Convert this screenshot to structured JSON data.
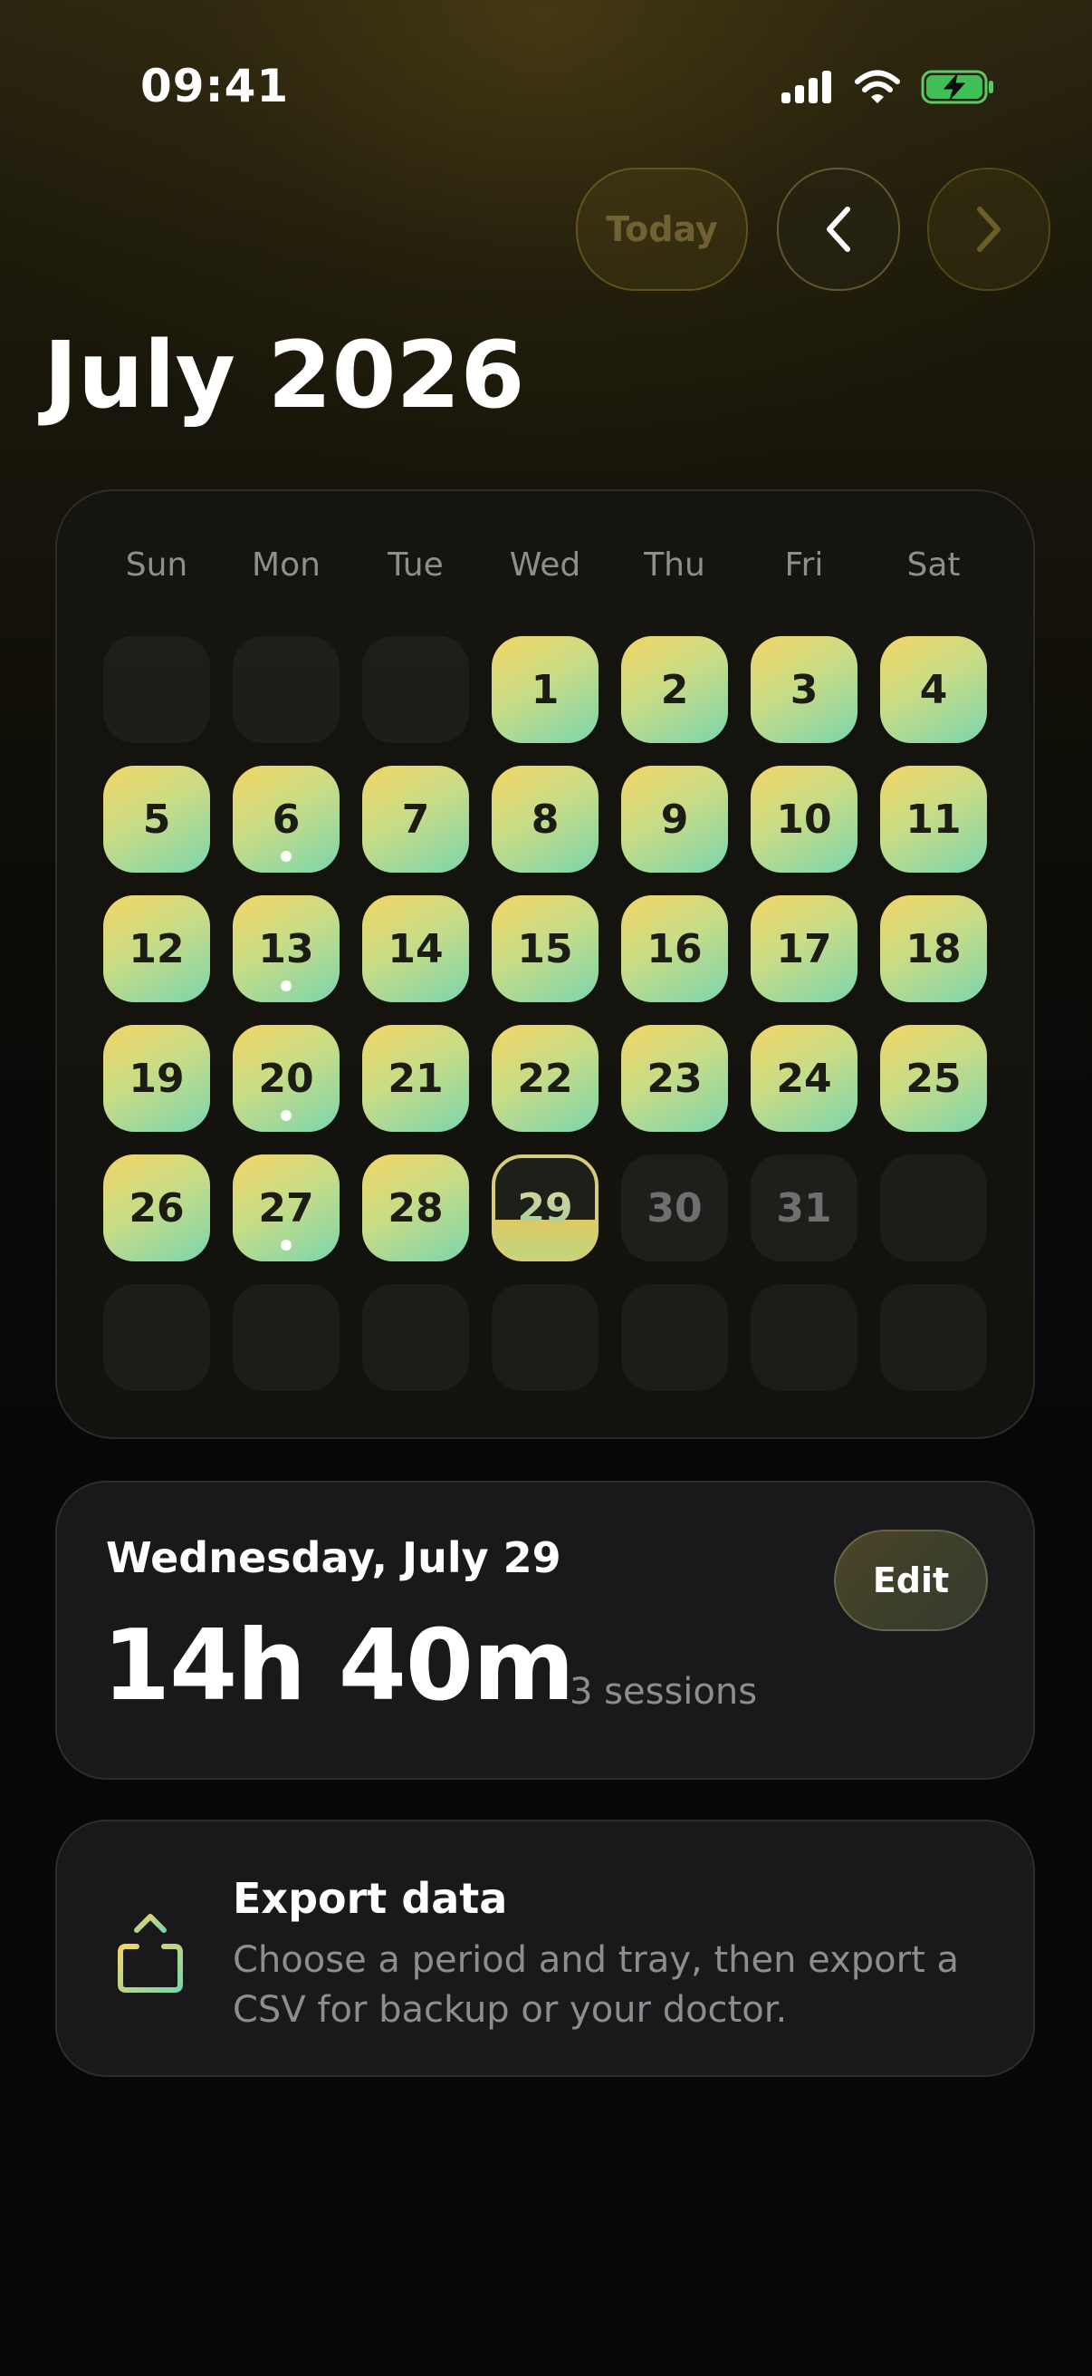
{
  "status_bar": {
    "time": "09:41"
  },
  "nav": {
    "today_label": "Today"
  },
  "calendar": {
    "month_title": "July 2026",
    "weekdays": [
      "Sun",
      "Mon",
      "Tue",
      "Wed",
      "Thu",
      "Fri",
      "Sat"
    ],
    "days": [
      {
        "label": "",
        "state": "empty"
      },
      {
        "label": "",
        "state": "empty"
      },
      {
        "label": "",
        "state": "empty"
      },
      {
        "label": "1",
        "state": "filled"
      },
      {
        "label": "2",
        "state": "filled"
      },
      {
        "label": "3",
        "state": "filled"
      },
      {
        "label": "4",
        "state": "filled"
      },
      {
        "label": "5",
        "state": "filled"
      },
      {
        "label": "6",
        "state": "filled",
        "dot": true
      },
      {
        "label": "7",
        "state": "filled"
      },
      {
        "label": "8",
        "state": "filled"
      },
      {
        "label": "9",
        "state": "filled"
      },
      {
        "label": "10",
        "state": "filled"
      },
      {
        "label": "11",
        "state": "filled"
      },
      {
        "label": "12",
        "state": "filled"
      },
      {
        "label": "13",
        "state": "filled",
        "dot": true
      },
      {
        "label": "14",
        "state": "filled"
      },
      {
        "label": "15",
        "state": "filled"
      },
      {
        "label": "16",
        "state": "filled"
      },
      {
        "label": "17",
        "state": "filled"
      },
      {
        "label": "18",
        "state": "filled"
      },
      {
        "label": "19",
        "state": "filled"
      },
      {
        "label": "20",
        "state": "filled",
        "dot": true
      },
      {
        "label": "21",
        "state": "filled"
      },
      {
        "label": "22",
        "state": "filled"
      },
      {
        "label": "23",
        "state": "filled"
      },
      {
        "label": "24",
        "state": "filled"
      },
      {
        "label": "25",
        "state": "filled"
      },
      {
        "label": "26",
        "state": "filled"
      },
      {
        "label": "27",
        "state": "filled",
        "dot": true
      },
      {
        "label": "28",
        "state": "filled"
      },
      {
        "label": "29",
        "state": "today",
        "progress": 0.38
      },
      {
        "label": "30",
        "state": "future"
      },
      {
        "label": "31",
        "state": "future"
      },
      {
        "label": "",
        "state": "empty"
      },
      {
        "label": "",
        "state": "empty"
      },
      {
        "label": "",
        "state": "empty"
      },
      {
        "label": "",
        "state": "empty"
      },
      {
        "label": "",
        "state": "empty"
      },
      {
        "label": "",
        "state": "empty"
      },
      {
        "label": "",
        "state": "empty"
      },
      {
        "label": "",
        "state": "empty"
      }
    ]
  },
  "summary": {
    "date": "Wednesday, July 29",
    "duration": "14h 40m",
    "sessions": "3 sessions",
    "edit_label": "Edit"
  },
  "export": {
    "title": "Export data",
    "description": "Choose a period and tray, then export a CSV for backup or your doctor."
  },
  "colors": {
    "accent_yellow": "#f2d564",
    "accent_green": "#7bd5ad",
    "background": "#07070a",
    "card": "#19191b"
  }
}
